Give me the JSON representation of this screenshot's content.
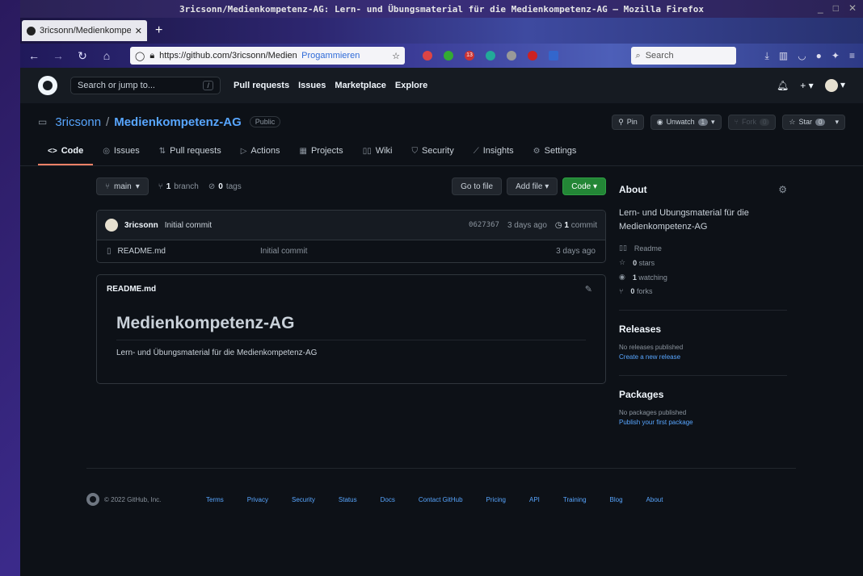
{
  "window": {
    "title": "3ricsonn/Medienkompetenz-AG: Lern- und Übungsmaterial für die Medienkompetenz-AG — Mozilla Firefox"
  },
  "browser": {
    "tab_label": "3ricsonn/Medienkompetenz",
    "url": "https://github.com/3ricsonn/Medienko",
    "url_suffix": "Progammieren",
    "search_placeholder": "Search",
    "ext_badge": "13"
  },
  "gh": {
    "search_placeholder": "Search or jump to...",
    "search_key": "/",
    "nav": [
      "Pull requests",
      "Issues",
      "Marketplace",
      "Explore"
    ]
  },
  "repo": {
    "owner": "3ricsonn",
    "sep": "/",
    "name": "Medienkompetenz-AG",
    "visibility": "Public",
    "pin": "Pin",
    "unwatch": "Unwatch",
    "unwatch_count": "1",
    "fork": "Fork",
    "fork_count": "0",
    "star": "Star",
    "star_count": "0"
  },
  "tabs": [
    "Code",
    "Issues",
    "Pull requests",
    "Actions",
    "Projects",
    "Wiki",
    "Security",
    "Insights",
    "Settings"
  ],
  "toolbar": {
    "branch": "main",
    "branch_count": "1",
    "branch_label": "branch",
    "tag_count": "0",
    "tag_label": "tags",
    "goto": "Go to file",
    "add": "Add file",
    "code": "Code"
  },
  "commit": {
    "author": "3ricsonn",
    "message": "Initial commit",
    "sha": "0627367",
    "time": "3 days ago",
    "count": "1",
    "count_label": "commit"
  },
  "files": [
    {
      "name": "README.md",
      "commit": "Initial commit",
      "date": "3 days ago"
    }
  ],
  "readme": {
    "filename": "README.md",
    "heading": "Medienkompetenz-AG",
    "body": "Lern- und Übungsmaterial für die Medienkompetenz-AG"
  },
  "about": {
    "title": "About",
    "description": "Lern- und Ubungsmaterial für die Medienkompetenz-AG",
    "readme": "Readme",
    "stars": "0",
    "stars_label": "stars",
    "watching": "1",
    "watching_label": "watching",
    "forks": "0",
    "forks_label": "forks"
  },
  "releases": {
    "title": "Releases",
    "none": "No releases published",
    "link": "Create a new release"
  },
  "packages": {
    "title": "Packages",
    "none": "No packages published",
    "link": "Publish your first package"
  },
  "footer": {
    "copyright": "© 2022 GitHub, Inc.",
    "links": [
      "Terms",
      "Privacy",
      "Security",
      "Status",
      "Docs",
      "Contact GitHub",
      "Pricing",
      "API",
      "Training",
      "Blog",
      "About"
    ]
  }
}
